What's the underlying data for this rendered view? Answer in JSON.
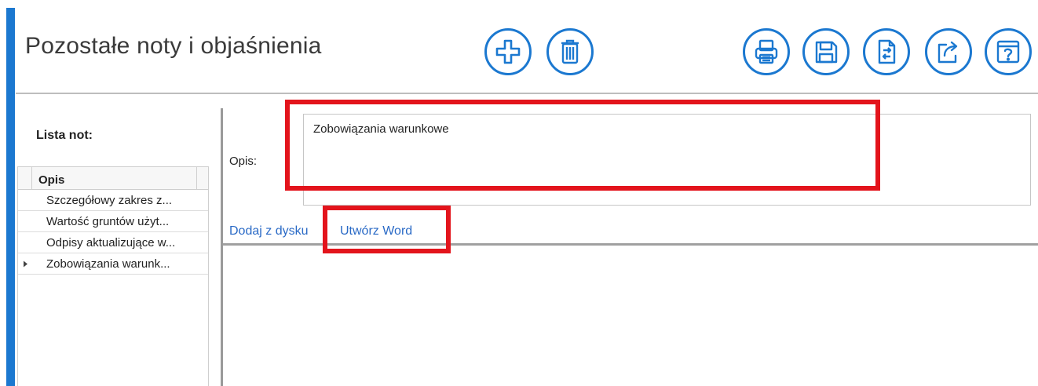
{
  "header": {
    "title": "Pozostałe noty i objaśnienia",
    "buttons": [
      {
        "name": "add-button",
        "icon": "plus-icon"
      },
      {
        "name": "delete-button",
        "icon": "trash-icon"
      },
      {
        "name": "print-button",
        "icon": "printer-icon"
      },
      {
        "name": "save-button",
        "icon": "floppy-disk-icon"
      },
      {
        "name": "document-swap-button",
        "icon": "document-swap-icon"
      },
      {
        "name": "export-button",
        "icon": "share-arrow-icon"
      },
      {
        "name": "help-button",
        "icon": "help-window-icon"
      }
    ]
  },
  "left_panel": {
    "label": "Lista not:",
    "grid": {
      "column": "Opis",
      "rows": [
        {
          "text": "Szczegółowy zakres z...",
          "selected": false
        },
        {
          "text": "Wartość gruntów użyt...",
          "selected": false
        },
        {
          "text": "Odpisy aktualizujące w...",
          "selected": false
        },
        {
          "text": "Zobowiązania warunk...",
          "selected": true
        }
      ]
    }
  },
  "detail": {
    "opis_label": "Opis:",
    "opis_value": "Zobowiązania warunkowe",
    "links": {
      "add_from_disk": "Dodaj z dysku",
      "create_word": "Utwórz Word"
    }
  },
  "colors": {
    "accent": "#1b78d0",
    "highlight": "#e3141c",
    "link": "#2a6ac6"
  }
}
